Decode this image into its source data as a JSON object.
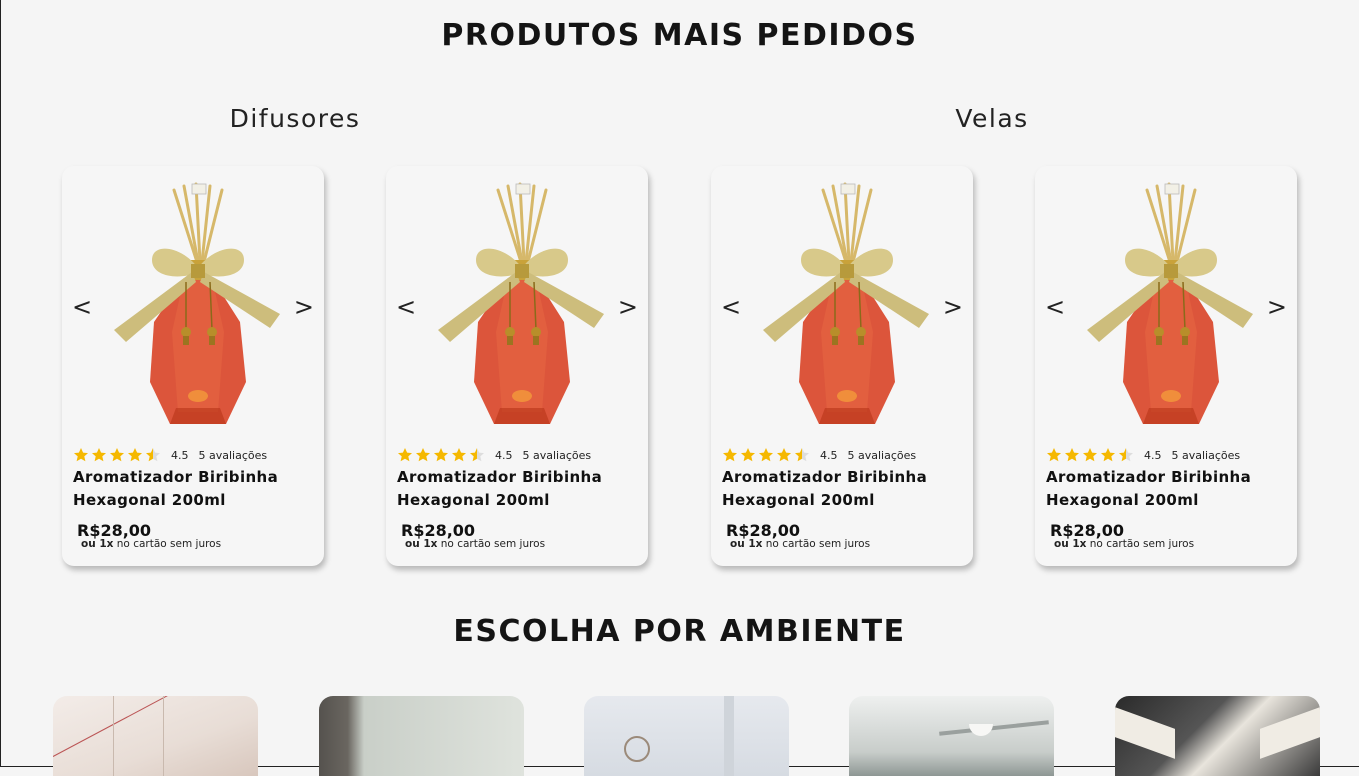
{
  "headings": {
    "most_ordered": "PRODUTOS MAIS PEDIDOS",
    "by_environment": "ESCOLHA POR AMBIENTE"
  },
  "categories": [
    "Difusores",
    "Velas"
  ],
  "carousel": {
    "prev_icon": "chevron-left-icon",
    "next_icon": "chevron-right-icon",
    "prev_glyph": "<",
    "next_glyph": ">"
  },
  "products": [
    {
      "name": "Aromatizador Biribinha Hexagonal 200ml",
      "rating": "4.5",
      "rating_value": 4.5,
      "reviews": "5 avaliações",
      "price": "R$28,00",
      "installment_bold": "ou 1x",
      "installment_text": " no cartão sem juros"
    },
    {
      "name": "Aromatizador Biribinha Hexagonal 200ml",
      "rating": "4.5",
      "rating_value": 4.5,
      "reviews": "5 avaliações",
      "price": "R$28,00",
      "installment_bold": "ou 1x",
      "installment_text": " no cartão sem juros"
    },
    {
      "name": "Aromatizador Biribinha Hexagonal 200ml",
      "rating": "4.5",
      "rating_value": 4.5,
      "reviews": "5 avaliações",
      "price": "R$28,00",
      "installment_bold": "ou 1x",
      "installment_text": " no cartão sem juros"
    },
    {
      "name": "Aromatizador Biribinha Hexagonal 200ml",
      "rating": "4.5",
      "rating_value": 4.5,
      "reviews": "5 avaliações",
      "price": "R$28,00",
      "installment_bold": "ou 1x",
      "installment_text": " no cartão sem juros"
    }
  ],
  "colors": {
    "star": "#f5b800",
    "liquid": "#d9462a",
    "ribbon": "#d8c98a",
    "background": "#f5f5f5"
  },
  "environments": [
    {
      "icon": "room-photo-1"
    },
    {
      "icon": "room-photo-2"
    },
    {
      "icon": "room-photo-3"
    },
    {
      "icon": "room-photo-4"
    },
    {
      "icon": "room-photo-5"
    }
  ]
}
